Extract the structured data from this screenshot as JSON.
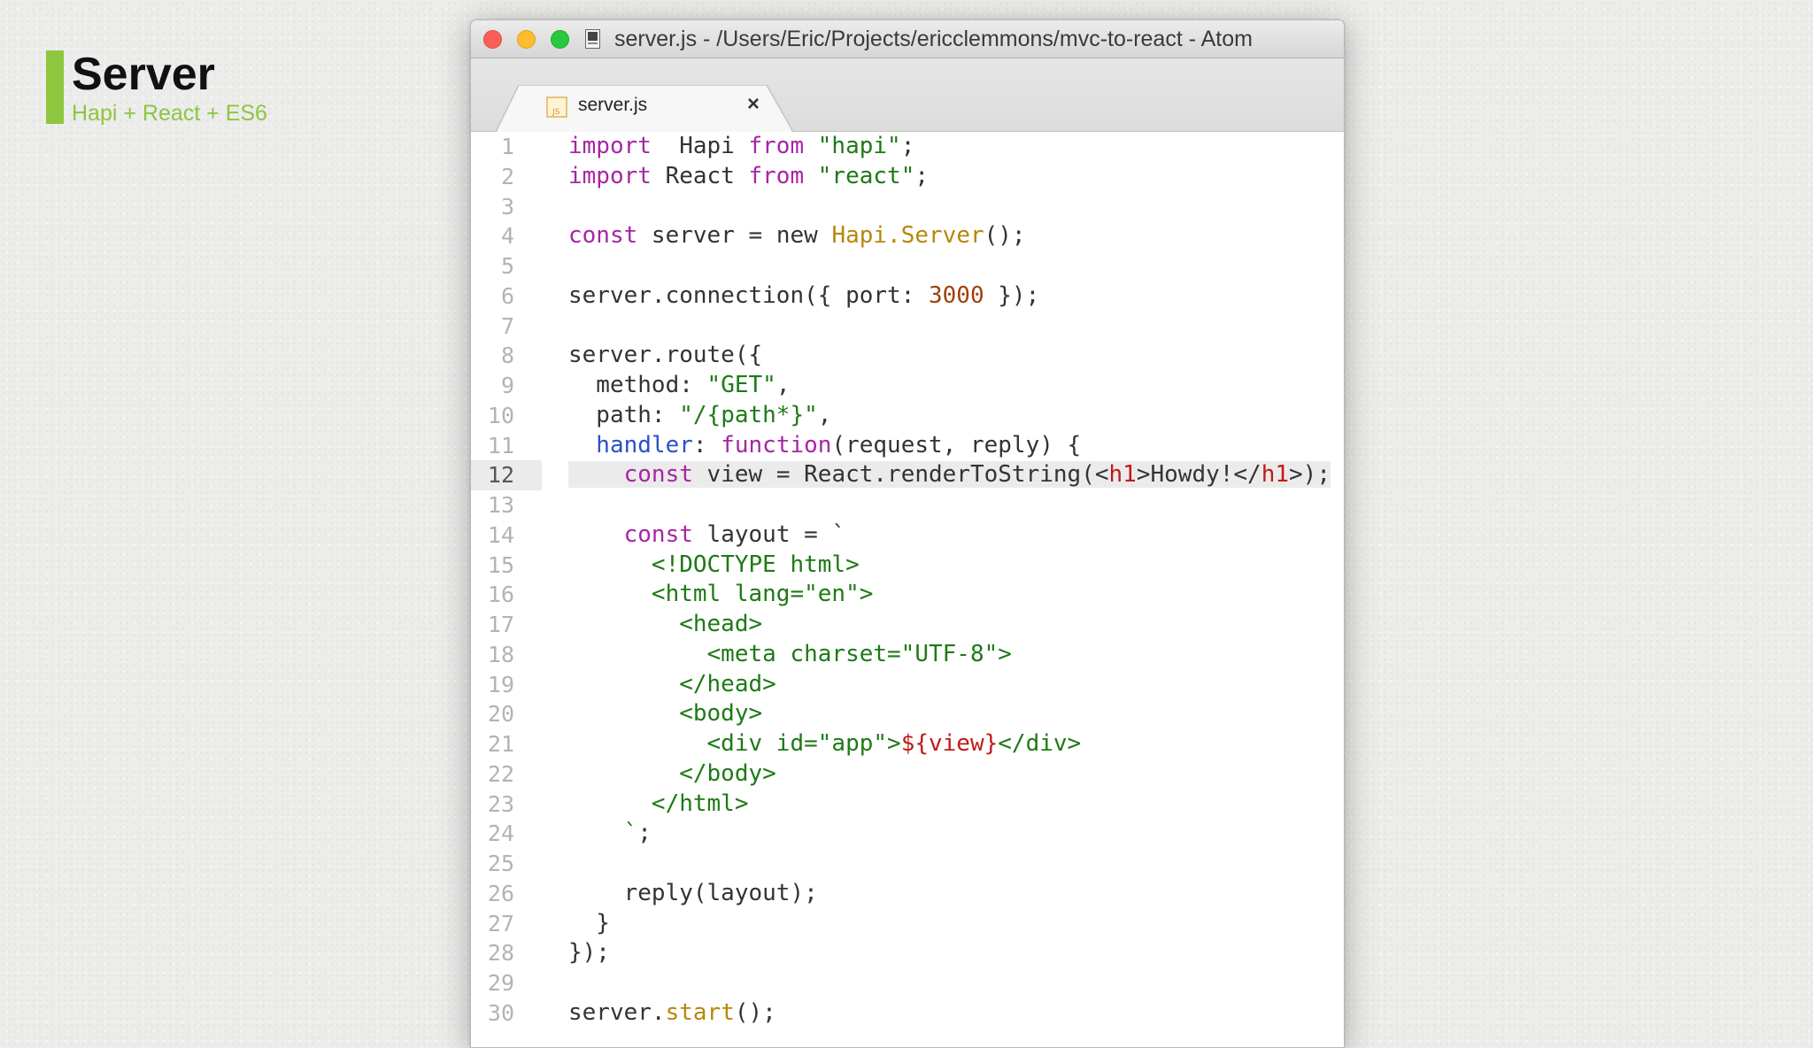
{
  "slide": {
    "title": "Server",
    "subtitle": "Hapi + React + ES6",
    "accent_color": "#8dc63f"
  },
  "window": {
    "title": "server.js - /Users/Eric/Projects/ericclemmons/mvc-to-react - Atom",
    "traffic_lights": [
      "close",
      "minimize",
      "zoom"
    ]
  },
  "tabs": [
    {
      "label": "server.js",
      "icon": "js-file-icon",
      "close_glyph": "×",
      "active": true
    }
  ],
  "editor": {
    "active_line": 12,
    "colors": {
      "keyword": "#a626a4",
      "string": "#1e7a16",
      "class": "#b8860b",
      "number": "#a0400b",
      "property": "#2a50c8",
      "jsx_tag": "#c01a1a"
    },
    "lines": [
      {
        "number": "1",
        "segments": [
          [
            "kw",
            "import"
          ],
          [
            "",
            "  Hapi "
          ],
          [
            "kw",
            "from"
          ],
          [
            "",
            " "
          ],
          [
            "str",
            "\"hapi\""
          ],
          [
            "",
            ";"
          ]
        ]
      },
      {
        "number": "2",
        "segments": [
          [
            "kw",
            "import"
          ],
          [
            "",
            " React "
          ],
          [
            "kw",
            "from"
          ],
          [
            "",
            " "
          ],
          [
            "str",
            "\"react\""
          ],
          [
            "",
            ";"
          ]
        ]
      },
      {
        "number": "3",
        "segments": []
      },
      {
        "number": "4",
        "segments": [
          [
            "kw",
            "const"
          ],
          [
            "",
            " server = new "
          ],
          [
            "fn",
            "Hapi.Server"
          ],
          [
            "",
            "();"
          ]
        ]
      },
      {
        "number": "5",
        "segments": []
      },
      {
        "number": "6",
        "segments": [
          [
            "",
            "server.connection({ port: "
          ],
          [
            "num",
            "3000"
          ],
          [
            "",
            " });"
          ]
        ]
      },
      {
        "number": "7",
        "segments": []
      },
      {
        "number": "8",
        "segments": [
          [
            "",
            "server.route({"
          ]
        ]
      },
      {
        "number": "9",
        "segments": [
          [
            "",
            "  method: "
          ],
          [
            "str",
            "\"GET\""
          ],
          [
            "",
            ","
          ]
        ]
      },
      {
        "number": "10",
        "segments": [
          [
            "",
            "  path: "
          ],
          [
            "str",
            "\"/{path*}\""
          ],
          [
            "",
            ","
          ]
        ]
      },
      {
        "number": "11",
        "segments": [
          [
            "prop",
            "  handler"
          ],
          [
            "",
            ": "
          ],
          [
            "kw",
            "function"
          ],
          [
            "",
            "(request, reply) {"
          ]
        ]
      },
      {
        "number": "12",
        "segments": [
          [
            "",
            "    "
          ],
          [
            "kw",
            "const"
          ],
          [
            "",
            " view = React.renderToString(<"
          ],
          [
            "tag",
            "h1"
          ],
          [
            "",
            ">Howdy!</"
          ],
          [
            "tag",
            "h1"
          ],
          [
            "",
            ">);"
          ]
        ]
      },
      {
        "number": "13",
        "segments": []
      },
      {
        "number": "14",
        "segments": [
          [
            "",
            "    "
          ],
          [
            "kw",
            "const"
          ],
          [
            "",
            " layout = `"
          ]
        ]
      },
      {
        "number": "15",
        "segments": [
          [
            "str",
            "      <!DOCTYPE html>"
          ]
        ]
      },
      {
        "number": "16",
        "segments": [
          [
            "str",
            "      <html lang=\"en\">"
          ]
        ]
      },
      {
        "number": "17",
        "segments": [
          [
            "str",
            "        <head>"
          ]
        ]
      },
      {
        "number": "18",
        "segments": [
          [
            "str",
            "          <meta charset=\"UTF-8\">"
          ]
        ]
      },
      {
        "number": "19",
        "segments": [
          [
            "str",
            "        </head>"
          ]
        ]
      },
      {
        "number": "20",
        "segments": [
          [
            "str",
            "        <body>"
          ]
        ]
      },
      {
        "number": "21",
        "segments": [
          [
            "str",
            "          <div id=\"app\">"
          ],
          [
            "tag",
            "${view}"
          ],
          [
            "str",
            "</div>"
          ]
        ]
      },
      {
        "number": "22",
        "segments": [
          [
            "str",
            "        </body>"
          ]
        ]
      },
      {
        "number": "23",
        "segments": [
          [
            "str",
            "      </html>"
          ]
        ]
      },
      {
        "number": "24",
        "segments": [
          [
            "str",
            "    `"
          ],
          [
            "",
            ";"
          ]
        ]
      },
      {
        "number": "25",
        "segments": []
      },
      {
        "number": "26",
        "segments": [
          [
            "",
            "    reply(layout);"
          ]
        ]
      },
      {
        "number": "27",
        "segments": [
          [
            "",
            "  }"
          ]
        ]
      },
      {
        "number": "28",
        "segments": [
          [
            "",
            "});"
          ]
        ]
      },
      {
        "number": "29",
        "segments": []
      },
      {
        "number": "30",
        "segments": [
          [
            "",
            "server."
          ],
          [
            "fn",
            "start"
          ],
          [
            "",
            "();"
          ]
        ]
      }
    ]
  }
}
